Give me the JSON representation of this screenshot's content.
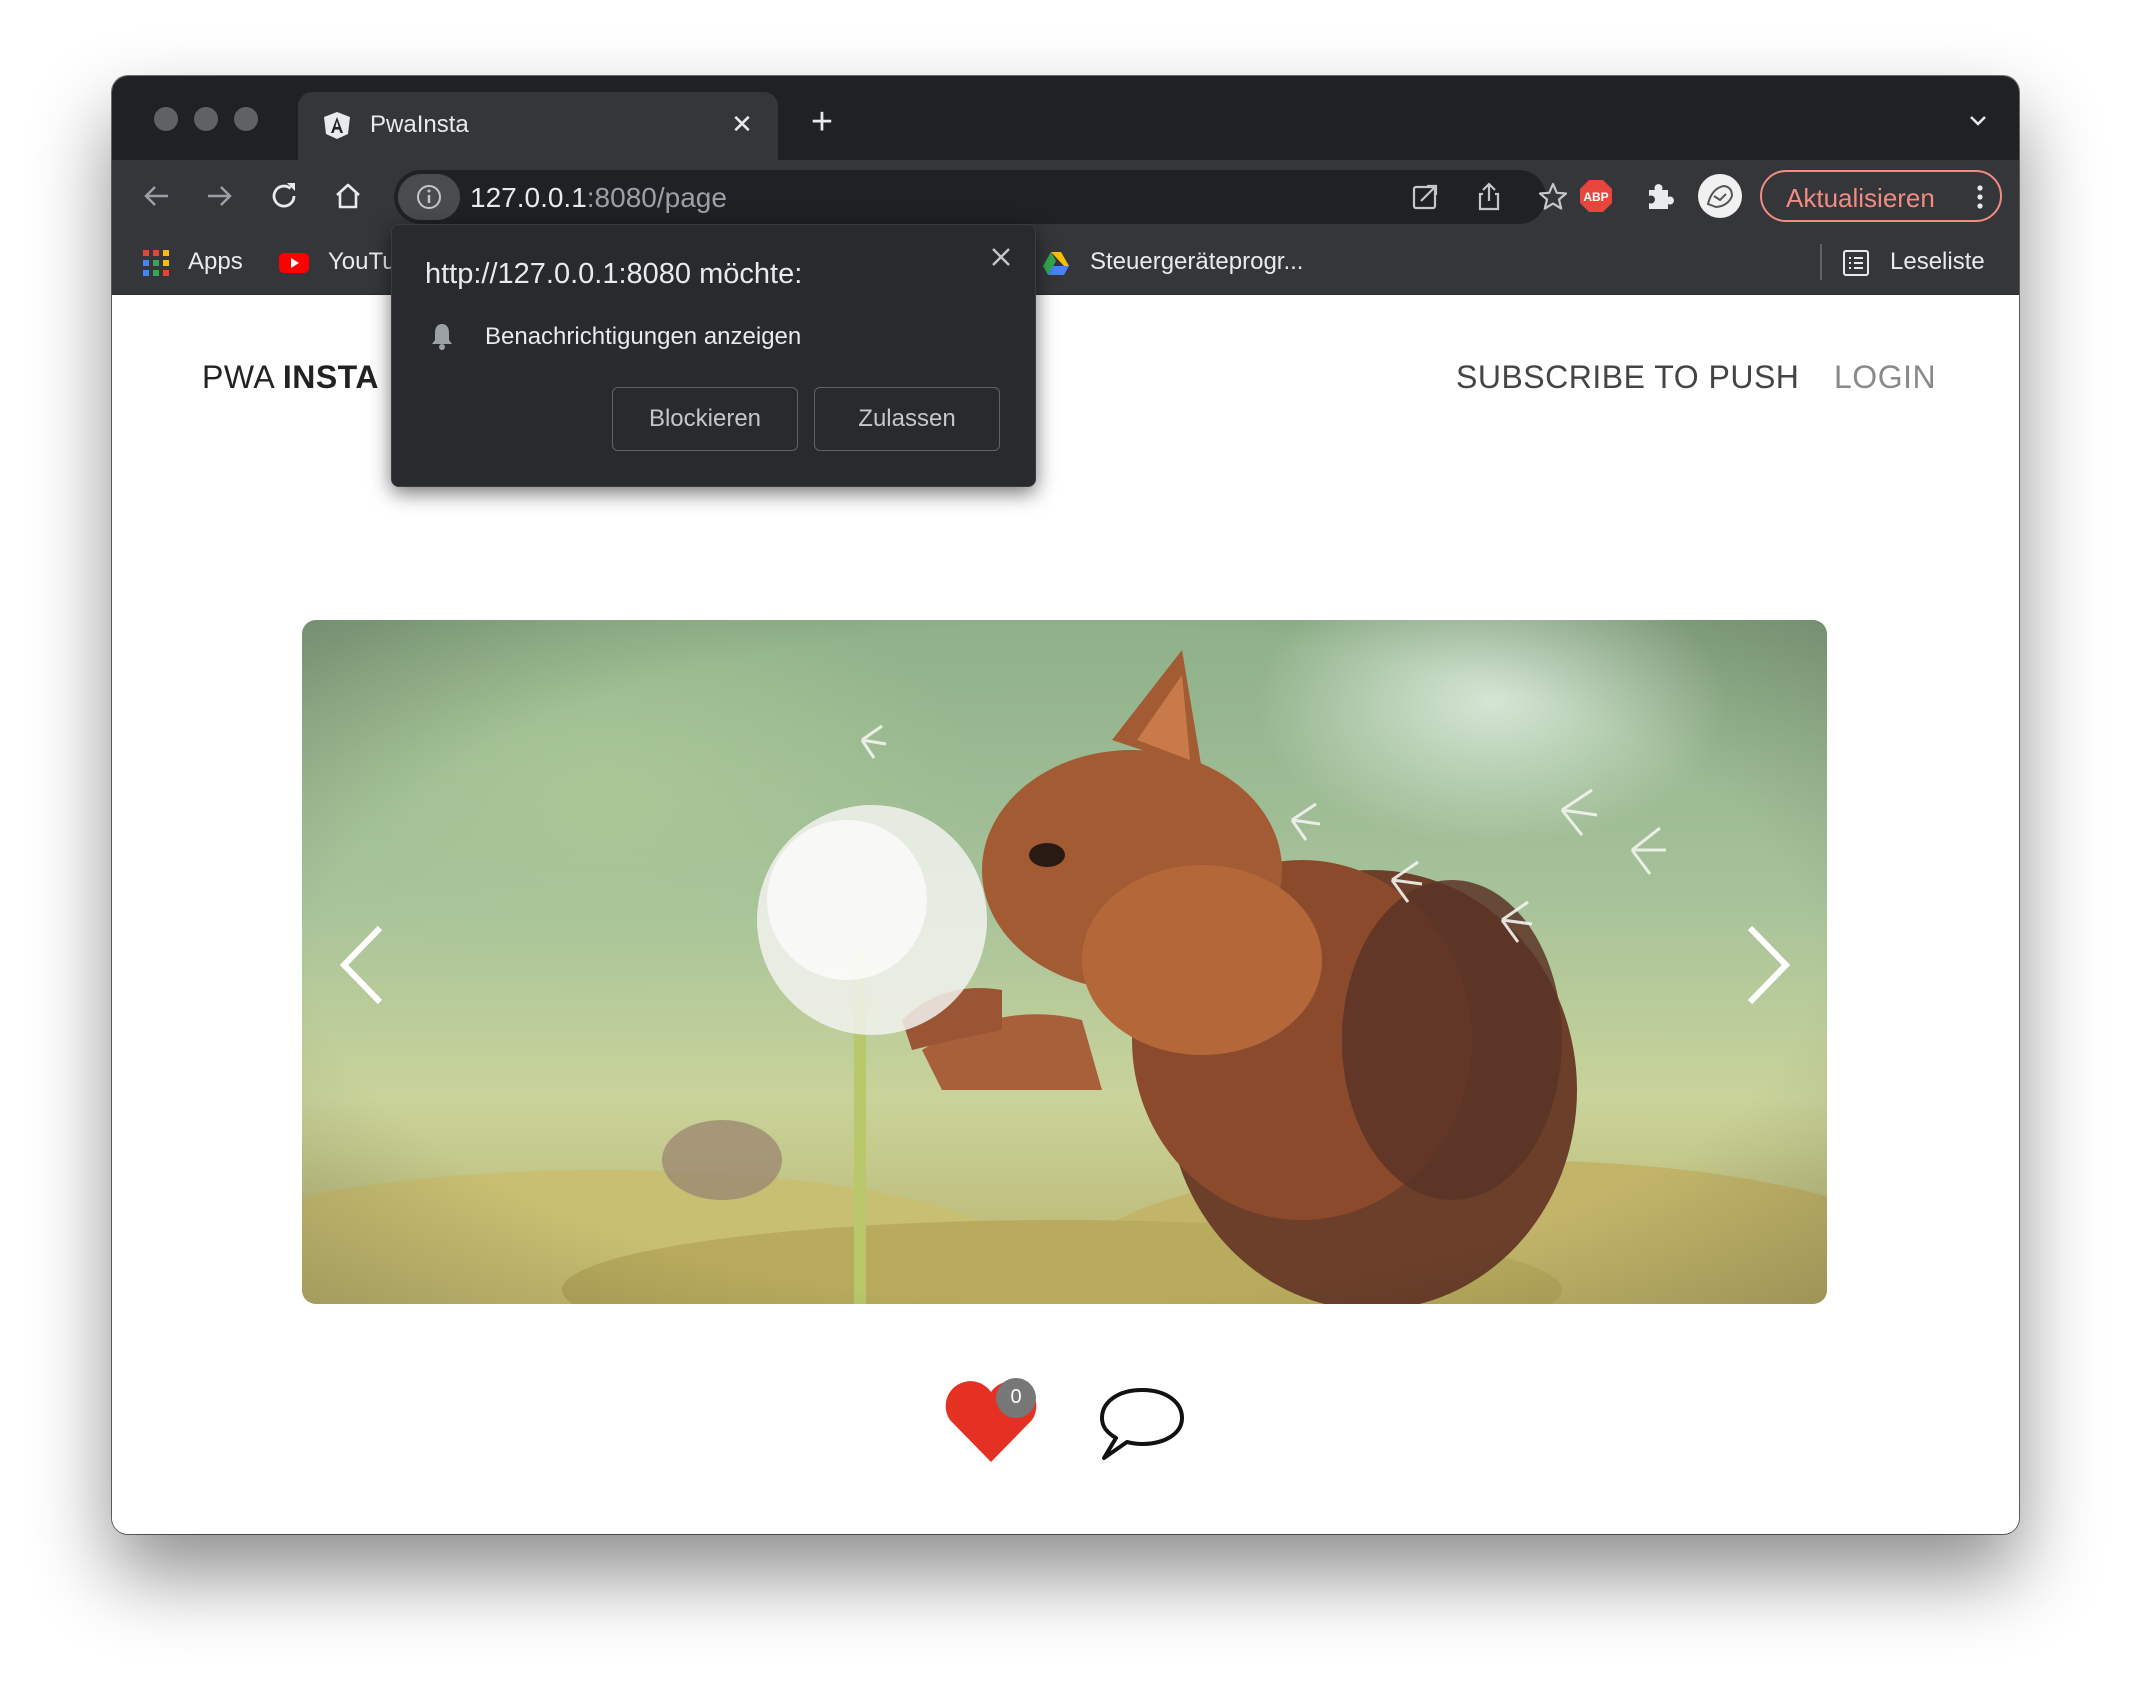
{
  "browser": {
    "tab": {
      "title": "PwaInsta",
      "favicon": "angular-logo-icon"
    },
    "new_tab_icon": "plus-icon",
    "toolbar": {
      "back_icon": "arrow-left-icon",
      "forward_icon": "arrow-right-icon",
      "reload_icon": "reload-icon",
      "home_icon": "home-icon",
      "url_host": "127.0.0.1",
      "url_rest": ":8080/page",
      "update_label": "Aktualisieren"
    },
    "bookmarks": {
      "apps": "Apps",
      "youtube": "YouTu",
      "drive": "Steuergeräteprogr...",
      "reading_list": "Leseliste"
    }
  },
  "permission_popup": {
    "title": "http://127.0.0.1:8080 möchte:",
    "request": "Benachrichtigungen anzeigen",
    "block_label": "Blockieren",
    "allow_label": "Zulassen"
  },
  "page": {
    "brand_light": "PWA ",
    "brand_bold": "INSTA",
    "nav": {
      "subscribe": "SUBSCRIBE TO PUSH",
      "login": "LOGIN"
    },
    "likes_count": "0"
  },
  "colors": {
    "like": "#e53024",
    "update_accent": "#f28b82",
    "chrome_dark": "#202124",
    "chrome_mid": "#35363a"
  }
}
